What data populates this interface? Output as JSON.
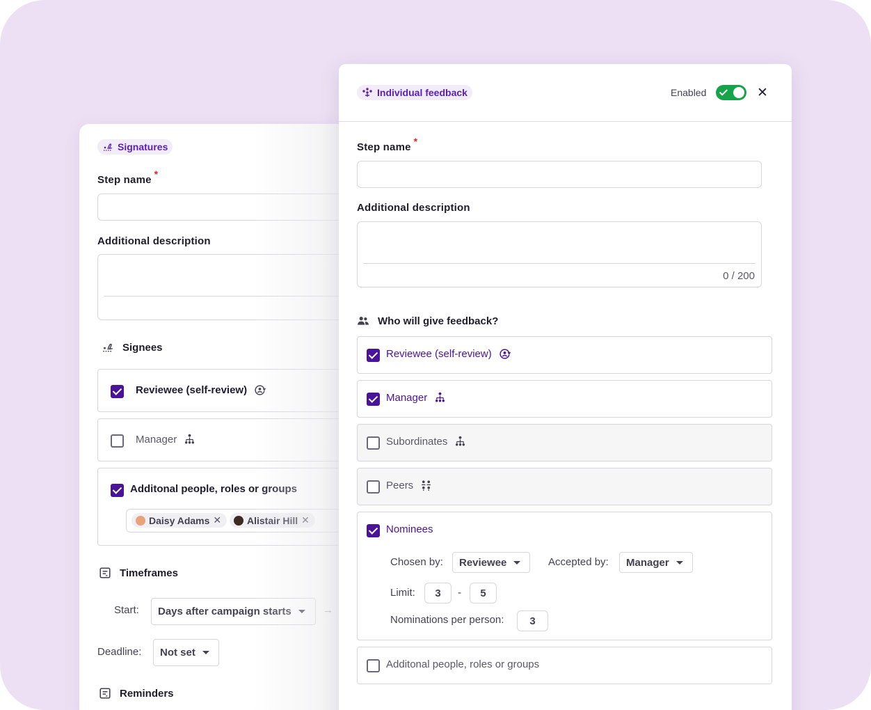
{
  "back_panel": {
    "chip_label": "Signatures",
    "step_name_label": "Step name",
    "required_mark": "*",
    "additional_description_label": "Additional description",
    "signees_title": "Signees",
    "options": [
      {
        "label": "Reviewee (self-review)",
        "checked": true
      },
      {
        "label": "Manager",
        "checked": false
      },
      {
        "label": "Additonal people, roles or groups",
        "checked": true
      }
    ],
    "people": [
      {
        "name": "Daisy Adams"
      },
      {
        "name": "Alistair Hill"
      }
    ],
    "timeframes_title": "Timeframes",
    "start_label": "Start:",
    "start_value": "Days after campaign starts",
    "deadline_label": "Deadline:",
    "deadline_value": "Not set",
    "reminders_title": "Reminders"
  },
  "front_panel": {
    "chip_label": "Individual feedback",
    "enabled_label": "Enabled",
    "enabled": true,
    "step_name_label": "Step name",
    "required_mark": "*",
    "additional_description_label": "Additional description",
    "char_count": "0 / 200",
    "feedback_title": "Who will give feedback?",
    "options": [
      {
        "label": "Reviewee (self-review)",
        "checked": true
      },
      {
        "label": "Manager",
        "checked": true
      },
      {
        "label": "Subordinates",
        "checked": false
      },
      {
        "label": "Peers",
        "checked": false
      },
      {
        "label": "Nominees",
        "checked": true
      },
      {
        "label": "Additonal people, roles or groups",
        "checked": false
      }
    ],
    "nominees": {
      "chosen_by_label": "Chosen by:",
      "chosen_by_value": "Reviewee",
      "accepted_by_label": "Accepted by:",
      "accepted_by_value": "Manager",
      "limit_label": "Limit:",
      "limit_min": "3",
      "limit_separator": "-",
      "limit_max": "5",
      "nominations_label": "Nominations per person:",
      "nominations_value": "3"
    }
  },
  "colors": {
    "accent": "#4a1399",
    "chip_text": "#5a1fb5",
    "toggle_on": "#17a34a",
    "required": "#e1262c",
    "background": "#ede0f4"
  }
}
